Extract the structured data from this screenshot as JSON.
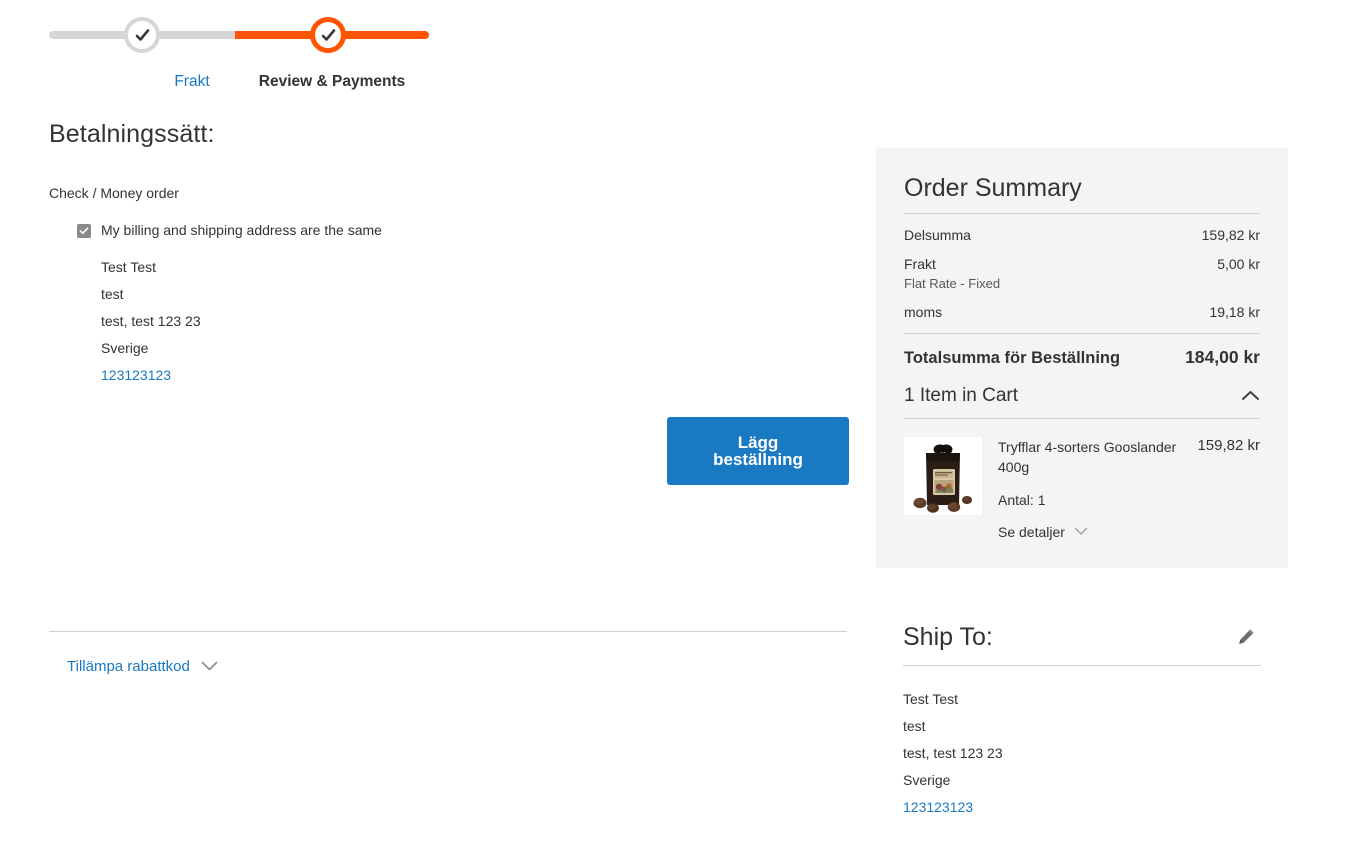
{
  "progress": {
    "steps": [
      {
        "label": "Frakt",
        "state": "completed"
      },
      {
        "label": "Review & Payments",
        "state": "active"
      }
    ],
    "colors": {
      "active": "#ff5501",
      "completed_track": "#d6d6d6",
      "link": "#1979c3"
    }
  },
  "payment": {
    "title": "Betalningssätt:",
    "method_name": "Check / Money order",
    "same_address_label": "My billing and shipping address are the same",
    "same_address_checked": true,
    "billing_address": [
      "Test Test",
      "test",
      "test, test 123 23",
      "Sverige"
    ],
    "billing_phone": "123123123",
    "place_order_label": "Lägg beställning",
    "discount_label": "Tillämpa rabattkod"
  },
  "summary": {
    "title": "Order Summary",
    "rows": [
      {
        "label": "Delsumma",
        "value": "159,82 kr",
        "sub": ""
      },
      {
        "label": "Frakt",
        "value": "5,00 kr",
        "sub": "Flat Rate - Fixed"
      },
      {
        "label": "moms",
        "value": "19,18 kr",
        "sub": ""
      }
    ],
    "grand_total": {
      "label": "Totalsumma för Beställning",
      "value": "184,00 kr"
    },
    "cart": {
      "header": "1 Item in Cart",
      "expanded": true,
      "items": [
        {
          "name": "Tryfflar 4-sorters Gooslander 400g",
          "price": "159,82 kr",
          "qty_label": "Antal: 1",
          "details_label": "Se detaljer",
          "thumb_alt": "product-thumbnail-truffle-gift-bag"
        }
      ]
    }
  },
  "ship_to": {
    "title": "Ship To:",
    "address": [
      "Test Test",
      "test",
      "test, test 123 23",
      "Sverige"
    ],
    "phone": "123123123"
  }
}
